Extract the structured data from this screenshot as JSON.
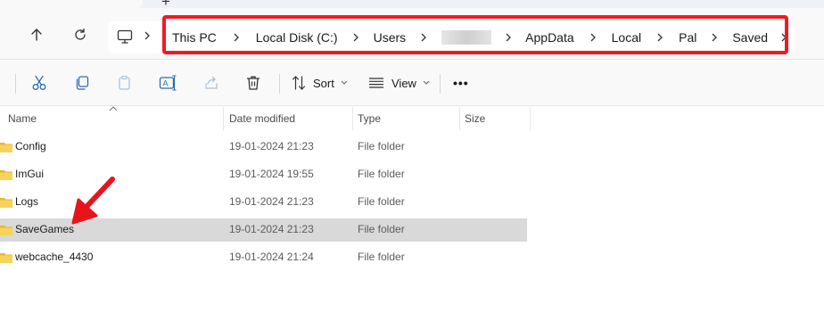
{
  "tabs": {
    "new_tab_label": "+"
  },
  "nav": {
    "breadcrumb": [
      "This PC",
      "Local Disk (C:)",
      "Users",
      "",
      "AppData",
      "Local",
      "Pal",
      "Saved"
    ]
  },
  "toolbar": {
    "sort_label": "Sort",
    "view_label": "View",
    "more_label": "•••"
  },
  "columns": {
    "name": "Name",
    "date": "Date modified",
    "type": "Type",
    "size": "Size"
  },
  "files": [
    {
      "name": "Config",
      "date": "19-01-2024 21:23",
      "type": "File folder",
      "size": ""
    },
    {
      "name": "ImGui",
      "date": "19-01-2024 19:55",
      "type": "File folder",
      "size": ""
    },
    {
      "name": "Logs",
      "date": "19-01-2024 21:23",
      "type": "File folder",
      "size": ""
    },
    {
      "name": "SaveGames",
      "date": "19-01-2024 21:23",
      "type": "File folder",
      "size": "",
      "selected": true
    },
    {
      "name": "webcache_4430",
      "date": "19-01-2024 21:24",
      "type": "File folder",
      "size": ""
    }
  ],
  "colors": {
    "highlight_border": "#ee1b24",
    "arrow": "#e8141c",
    "folder": "#f2c744",
    "selected_row": "#d9d9d9"
  }
}
